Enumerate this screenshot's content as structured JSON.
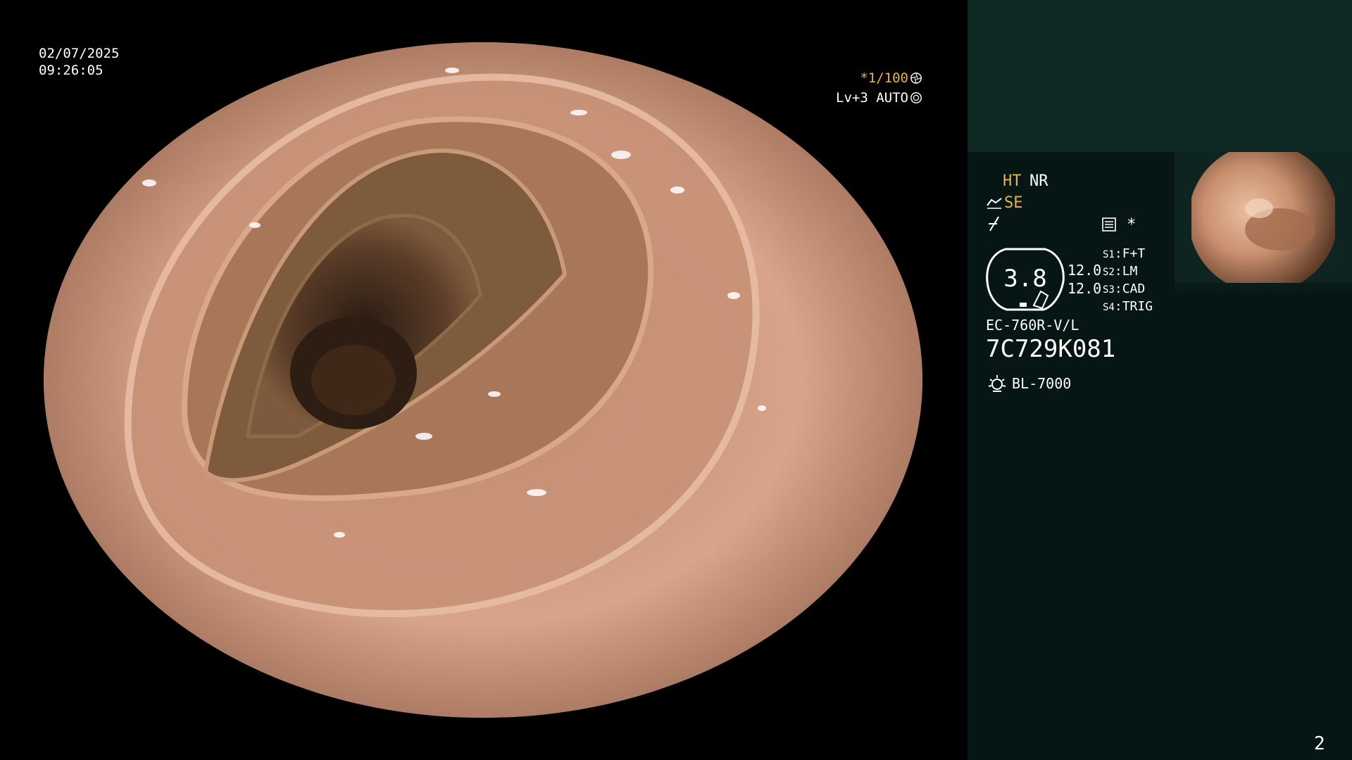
{
  "overlay": {
    "date": "02/07/2025",
    "time": "09:26:05",
    "shutter": "*1/100",
    "level": "Lv+3 AUTO"
  },
  "panel": {
    "ht": "HT",
    "nr": "NR",
    "se": "SE",
    "asterisk": "*",
    "gauge_value": "3.8",
    "value_a": "12.0",
    "value_b": "12.0",
    "switches": [
      {
        "key": "S1",
        "value": "F+T"
      },
      {
        "key": "S2",
        "value": "LM"
      },
      {
        "key": "S3",
        "value": "CAD"
      },
      {
        "key": "S4",
        "value": "TRIG"
      }
    ],
    "scope_model": "EC-760R-V/L",
    "serial": "7C729K081",
    "light_source": "BL-7000"
  },
  "page_number": "2",
  "icons": [
    "shutter-icon",
    "auto-iris-icon",
    "se-icon",
    "f-curve-icon",
    "structure-icon",
    "gauge-icon",
    "light-source-icon"
  ],
  "colors": {
    "accent_yellow": "#e9b43c",
    "panel_dark": "#061614",
    "panel_top": "#0e2824",
    "text_white": "#ffffff"
  }
}
